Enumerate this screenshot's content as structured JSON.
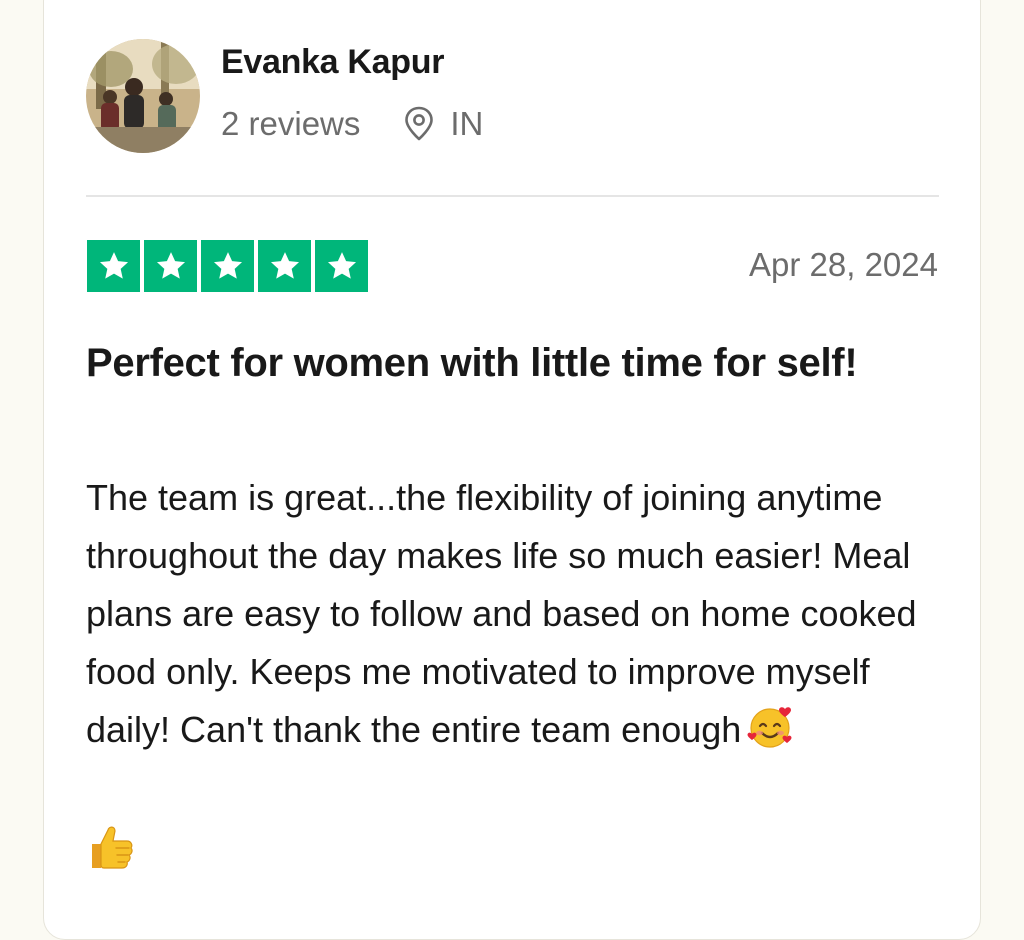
{
  "reviewer": {
    "name": "Evanka Kapur",
    "reviews_count": "2 reviews",
    "country": "IN",
    "avatar_icon": "reviewer-avatar-photo"
  },
  "review": {
    "rating": 5,
    "rating_max": 5,
    "date": "Apr 28, 2024",
    "title": "Perfect for women with little time for self!",
    "body": "The team is great...the flexibility of joining anytime throughout the day makes life so much easier! Meal plans are easy to follow and based on home cooked food only. Keeps me motivated to improve myself daily! Can't thank the entire team enough",
    "emojis": [
      "smiling-face-with-hearts-emoji",
      "thumbs-up-emoji"
    ]
  },
  "colors": {
    "star_green": "#00b67a",
    "text_dark": "#191919",
    "text_muted": "#6c6c6c",
    "page_background": "#fbfaf3",
    "card_background": "#ffffff"
  },
  "icons": {
    "location": "location-pin-icon",
    "star": "star-icon"
  }
}
